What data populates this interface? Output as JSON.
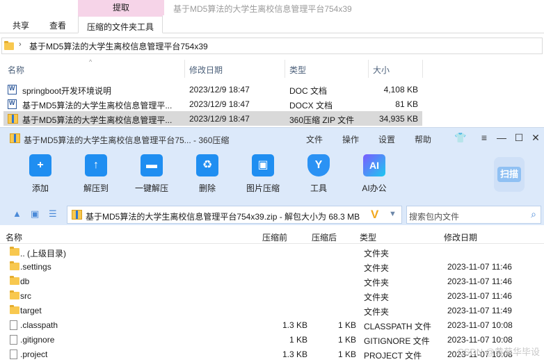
{
  "explorer": {
    "context_tab": "提取",
    "window_title": "基于MD5算法的大学生离校信息管理平台754x39",
    "tabs": [
      "共享",
      "查看",
      "压缩的文件夹工具"
    ],
    "address": "基于MD5算法的大学生离校信息管理平台754x39",
    "columns": [
      "名称",
      "修改日期",
      "类型",
      "大小"
    ],
    "rows": [
      {
        "name": "springboot开发环境说明",
        "date": "2023/12/9 18:47",
        "type": "DOC 文档",
        "size": "4,108 KB",
        "icon": "word-doc-icon"
      },
      {
        "name": "基于MD5算法的大学生离校信息管理平...",
        "date": "2023/12/9 18:47",
        "type": "DOCX 文档",
        "size": "81 KB",
        "icon": "word-doc-icon"
      },
      {
        "name": "基于MD5算法的大学生离校信息管理平...",
        "date": "2023/12/9 18:47",
        "type": "360压缩 ZIP 文件",
        "size": "34,935 KB",
        "icon": "zip-archive-icon"
      }
    ]
  },
  "zipper": {
    "title": "基于MD5算法的大学生离校信息管理平台75... - 360压缩",
    "menu": [
      "文件",
      "操作",
      "设置",
      "帮助"
    ],
    "toolbar": [
      {
        "label": "添加",
        "icon": "add-icon",
        "glyph": "+"
      },
      {
        "label": "解压到",
        "icon": "extract-to-icon",
        "glyph": "↑"
      },
      {
        "label": "一键解压",
        "icon": "quick-extract-icon",
        "glyph": "▬"
      },
      {
        "label": "删除",
        "icon": "delete-icon",
        "glyph": "♻"
      },
      {
        "label": "图片压缩",
        "icon": "image-compress-icon",
        "glyph": "▣"
      },
      {
        "label": "工具",
        "icon": "tools-icon",
        "glyph": "Y"
      },
      {
        "label": "AI办公",
        "icon": "ai-office-icon",
        "glyph": "AI"
      }
    ],
    "scan_label": "扫描",
    "path": "基于MD5算法的大学生离校信息管理平台754x39.zip - 解包大小为 68.3 MB",
    "search_placeholder": "搜索包内文件",
    "columns": [
      "名称",
      "压缩前",
      "压缩后",
      "类型",
      "修改日期"
    ],
    "rows": [
      {
        "name": ".. (上级目录)",
        "before": "",
        "after": "",
        "type": "文件夹",
        "date": "",
        "kind": "folder"
      },
      {
        "name": ".settings",
        "before": "",
        "after": "",
        "type": "文件夹",
        "date": "2023-11-07 11:46",
        "kind": "folder"
      },
      {
        "name": "db",
        "before": "",
        "after": "",
        "type": "文件夹",
        "date": "2023-11-07 11:46",
        "kind": "folder"
      },
      {
        "name": "src",
        "before": "",
        "after": "",
        "type": "文件夹",
        "date": "2023-11-07 11:46",
        "kind": "folder"
      },
      {
        "name": "target",
        "before": "",
        "after": "",
        "type": "文件夹",
        "date": "2023-11-07 11:49",
        "kind": "folder"
      },
      {
        "name": ".classpath",
        "before": "1.3 KB",
        "after": "1 KB",
        "type": "CLASSPATH 文件",
        "date": "2023-11-07 10:08",
        "kind": "file"
      },
      {
        "name": ".gitignore",
        "before": "1 KB",
        "after": "1 KB",
        "type": "GITIGNORE 文件",
        "date": "2023-11-07 10:08",
        "kind": "file"
      },
      {
        "name": ".project",
        "before": "1.3 KB",
        "after": "1 KB",
        "type": "PROJECT 文件",
        "date": "2023-11-07 10:08",
        "kind": "file"
      }
    ]
  },
  "watermark": "CSDN @黄菊华毕设"
}
